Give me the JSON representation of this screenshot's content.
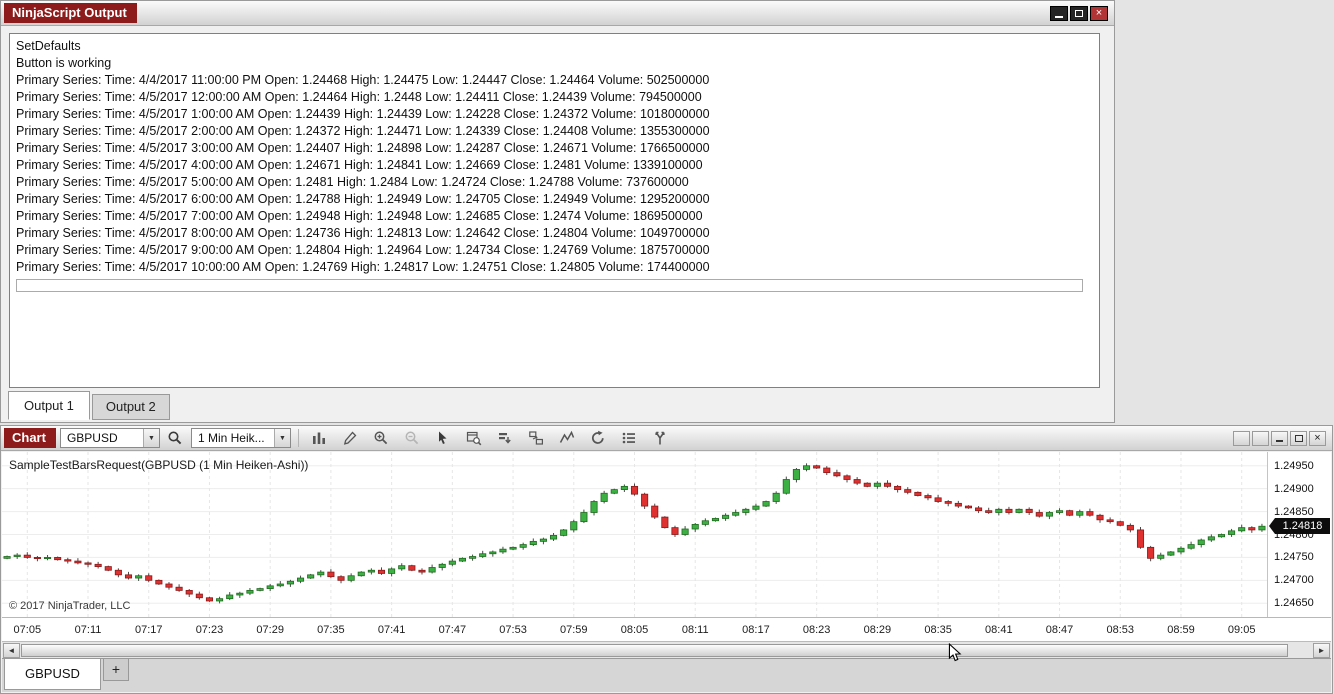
{
  "colors": {
    "accent": "#8e1b1b",
    "up": "#3cb043",
    "down": "#e03131"
  },
  "output_window": {
    "title": "NinjaScript Output",
    "window_buttons": [
      "minimize",
      "restore",
      "close"
    ],
    "lines": [
      "SetDefaults",
      "Button is working",
      "Primary Series: Time: 4/4/2017 11:00:00 PM Open: 1.24468 High: 1.24475 Low: 1.24447 Close: 1.24464 Volume: 502500000",
      "Primary Series: Time: 4/5/2017 12:00:00 AM Open: 1.24464 High: 1.2448 Low: 1.24411 Close: 1.24439 Volume: 794500000",
      "Primary Series: Time: 4/5/2017 1:00:00 AM Open: 1.24439 High: 1.24439 Low: 1.24228 Close: 1.24372 Volume: 1018000000",
      "Primary Series: Time: 4/5/2017 2:00:00 AM Open: 1.24372 High: 1.24471 Low: 1.24339 Close: 1.24408 Volume: 1355300000",
      "Primary Series: Time: 4/5/2017 3:00:00 AM Open: 1.24407 High: 1.24898 Low: 1.24287 Close: 1.24671 Volume: 1766500000",
      "Primary Series: Time: 4/5/2017 4:00:00 AM Open: 1.24671 High: 1.24841 Low: 1.24669 Close: 1.2481 Volume: 1339100000",
      "Primary Series: Time: 4/5/2017 5:00:00 AM Open: 1.2481 High: 1.2484 Low: 1.24724 Close: 1.24788 Volume: 737600000",
      "Primary Series: Time: 4/5/2017 6:00:00 AM Open: 1.24788 High: 1.24949 Low: 1.24705 Close: 1.24949 Volume: 1295200000",
      "Primary Series: Time: 4/5/2017 7:00:00 AM Open: 1.24948 High: 1.24948 Low: 1.24685 Close: 1.2474 Volume: 1869500000",
      "Primary Series: Time: 4/5/2017 8:00:00 AM Open: 1.24736 High: 1.24813 Low: 1.24642 Close: 1.24804 Volume: 1049700000",
      "Primary Series: Time: 4/5/2017 9:00:00 AM Open: 1.24804 High: 1.24964 Low: 1.24734 Close: 1.24769 Volume: 1875700000",
      "Primary Series: Time: 4/5/2017 10:00:00 AM Open: 1.24769 High: 1.24817 Low: 1.24751 Close: 1.24805 Volume: 174400000"
    ],
    "input_value": "",
    "tabs": [
      {
        "label": "Output 1",
        "active": true
      },
      {
        "label": "Output 2",
        "active": false
      }
    ]
  },
  "chart_window": {
    "title": "Chart",
    "toolbar": {
      "instrument_value": "GBPUSD",
      "interval_value": "1 Min Heik...",
      "icons": [
        "search",
        "chart-style",
        "drawing-tools",
        "zoom-in",
        "zoom-out",
        "cursor",
        "data-box",
        "chart-trader",
        "panels",
        "indicators",
        "reload",
        "data-series",
        "properties"
      ]
    },
    "window_buttons": [
      "instrument-link",
      "interval-link",
      "minimize",
      "maximize",
      "close"
    ],
    "chart_label": "SampleTestBarsRequest(GBPUSD (1 Min Heiken-Ashi))",
    "copyright": "© 2017 NinjaTrader, LLC",
    "price_marker": "1.24818",
    "bottom_tabs": [
      {
        "label": "GBPUSD",
        "active": true
      },
      {
        "label": "+",
        "active": false
      }
    ]
  },
  "chart_data": {
    "type": "candlestick",
    "style": "heiken-ashi",
    "title": "SampleTestBarsRequest(GBPUSD (1 Min Heiken-Ashi))",
    "instrument": "GBPUSD",
    "interval": "1 Min Heiken-Ashi",
    "x_start": "07:03",
    "x_step_minutes": 1,
    "x_ticks": [
      "07:05",
      "07:11",
      "07:17",
      "07:23",
      "07:29",
      "07:35",
      "07:41",
      "07:47",
      "07:53",
      "07:59",
      "08:05",
      "08:11",
      "08:17",
      "08:23",
      "08:29",
      "08:35",
      "08:41",
      "08:47",
      "08:53",
      "08:59",
      "09:05"
    ],
    "y_ticks": [
      1.2495,
      1.249,
      1.2485,
      1.248,
      1.2475,
      1.247,
      1.2465
    ],
    "ylim": [
      1.2462,
      1.2498
    ],
    "grid": true,
    "last_price": 1.24818,
    "up_color": "#3cb043",
    "down_color": "#e03131",
    "wick_color": "#4a4a4a",
    "closes": [
      1.24752,
      1.24755,
      1.2475,
      1.24748,
      1.2475,
      1.24745,
      1.24742,
      1.24738,
      1.24735,
      1.2473,
      1.24722,
      1.24712,
      1.24705,
      1.2471,
      1.247,
      1.24692,
      1.24685,
      1.24678,
      1.2467,
      1.24662,
      1.24655,
      1.2466,
      1.24668,
      1.24672,
      1.24678,
      1.24682,
      1.24688,
      1.24692,
      1.24698,
      1.24705,
      1.24712,
      1.24718,
      1.24708,
      1.247,
      1.2471,
      1.24718,
      1.24722,
      1.24715,
      1.24725,
      1.24732,
      1.24722,
      1.24718,
      1.24728,
      1.24735,
      1.24742,
      1.24748,
      1.24752,
      1.24758,
      1.24762,
      1.24768,
      1.24772,
      1.24778,
      1.24785,
      1.2479,
      1.24798,
      1.2481,
      1.24828,
      1.24848,
      1.24872,
      1.2489,
      1.24898,
      1.24905,
      1.24888,
      1.24862,
      1.24838,
      1.24815,
      1.248,
      1.24812,
      1.24822,
      1.2483,
      1.24835,
      1.24842,
      1.24848,
      1.24855,
      1.24862,
      1.24872,
      1.2489,
      1.2492,
      1.24942,
      1.2495,
      1.24945,
      1.24935,
      1.24928,
      1.2492,
      1.24912,
      1.24905,
      1.24912,
      1.24905,
      1.24898,
      1.24892,
      1.24885,
      1.2488,
      1.24872,
      1.24868,
      1.24862,
      1.24858,
      1.24852,
      1.24848,
      1.24855,
      1.24848,
      1.24855,
      1.24848,
      1.2484,
      1.24848,
      1.24852,
      1.24842,
      1.2485,
      1.24842,
      1.24832,
      1.24828,
      1.2482,
      1.2481,
      1.24772,
      1.24748,
      1.24755,
      1.24762,
      1.2477,
      1.24778,
      1.24788,
      1.24795,
      1.248,
      1.24808,
      1.24815,
      1.2481,
      1.24818
    ]
  }
}
